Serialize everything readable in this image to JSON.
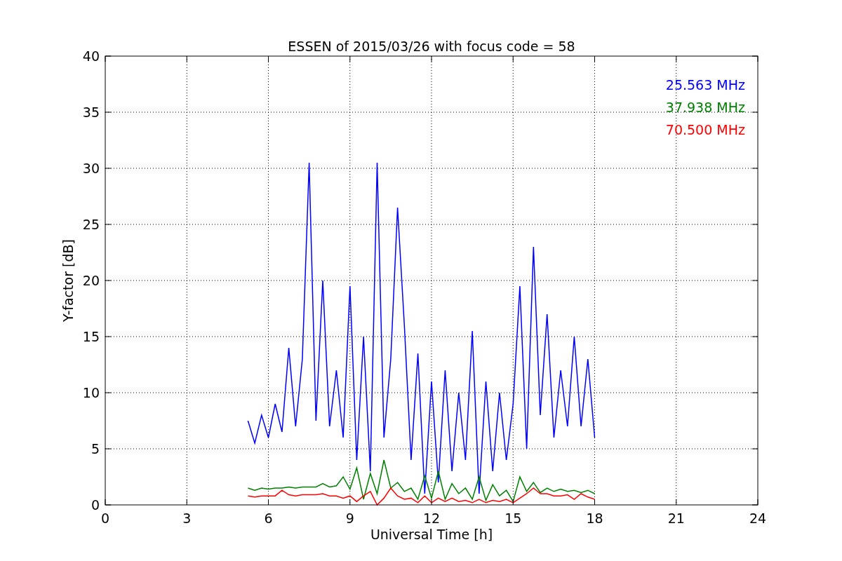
{
  "chart_data": {
    "type": "line",
    "title": "ESSEN of 2015/03/26 with focus code = 58",
    "xlabel": "Universal Time [h]",
    "ylabel": "Y-factor [dB]",
    "x": [
      5.25,
      5.5,
      5.75,
      6.0,
      6.25,
      6.5,
      6.75,
      7.0,
      7.25,
      7.5,
      7.75,
      8.0,
      8.25,
      8.5,
      8.75,
      9.0,
      9.25,
      9.5,
      9.75,
      10.0,
      10.25,
      10.5,
      10.75,
      11.0,
      11.25,
      11.5,
      11.75,
      12.0,
      12.25,
      12.5,
      12.75,
      13.0,
      13.25,
      13.5,
      13.75,
      14.0,
      14.25,
      14.5,
      14.75,
      15.0,
      15.25,
      15.5,
      15.75,
      16.0,
      16.25,
      16.5,
      16.75,
      17.0,
      17.25,
      17.5,
      17.75,
      18.0
    ],
    "series": [
      {
        "name": "25.563 MHz",
        "color": "#0000ff",
        "values": [
          7.5,
          5.5,
          8,
          6,
          9,
          6.5,
          14,
          7,
          13,
          30.5,
          7.5,
          20,
          7,
          12,
          6,
          19.5,
          4,
          15,
          3,
          30.5,
          6,
          13,
          26.5,
          16,
          4,
          13.5,
          1,
          11,
          2,
          12,
          3,
          10,
          4,
          15.5,
          1,
          11,
          3,
          10,
          4,
          9,
          19.5,
          5,
          23,
          8,
          17,
          6,
          12,
          7,
          15,
          7,
          13,
          6
        ]
      },
      {
        "name": "37.938 MHz",
        "color": "#008000",
        "values": [
          1.5,
          1.3,
          1.5,
          1.4,
          1.5,
          1.5,
          1.6,
          1.5,
          1.6,
          1.6,
          1.6,
          1.9,
          1.6,
          1.7,
          2.5,
          1.4,
          3.3,
          0.5,
          2.8,
          1.0,
          4.0,
          1.5,
          2.0,
          1.2,
          1.5,
          0.5,
          2.6,
          0.6,
          3.0,
          0.5,
          1.9,
          1.0,
          1.5,
          0.5,
          2.5,
          0.4,
          1.8,
          0.8,
          1.3,
          0.3,
          2.5,
          1.2,
          2.0,
          1.1,
          1.5,
          1.2,
          1.4,
          1.2,
          1.3,
          1.1,
          1.3,
          1.0
        ]
      },
      {
        "name": "70.500 MHz",
        "color": "#ff0000",
        "values": [
          0.8,
          0.7,
          0.8,
          0.8,
          0.8,
          1.3,
          0.9,
          0.8,
          0.9,
          0.9,
          0.9,
          1.0,
          0.8,
          0.8,
          0.6,
          0.8,
          0.3,
          0.8,
          1.2,
          0.0,
          0.6,
          1.5,
          0.8,
          0.5,
          0.6,
          0.2,
          0.8,
          0.2,
          0.6,
          0.3,
          0.6,
          0.3,
          0.4,
          0.2,
          0.5,
          0.2,
          0.4,
          0.3,
          0.5,
          0.2,
          0.6,
          1.0,
          1.5,
          1.0,
          1.0,
          0.8,
          0.8,
          0.9,
          0.5,
          1.0,
          0.7,
          0.5
        ]
      }
    ],
    "xlim": [
      0,
      24
    ],
    "ylim": [
      0,
      40
    ],
    "xticks": [
      0,
      3,
      6,
      9,
      12,
      15,
      18,
      21,
      24
    ],
    "yticks": [
      0,
      5,
      10,
      15,
      20,
      25,
      30,
      35,
      40
    ],
    "grid": true
  }
}
